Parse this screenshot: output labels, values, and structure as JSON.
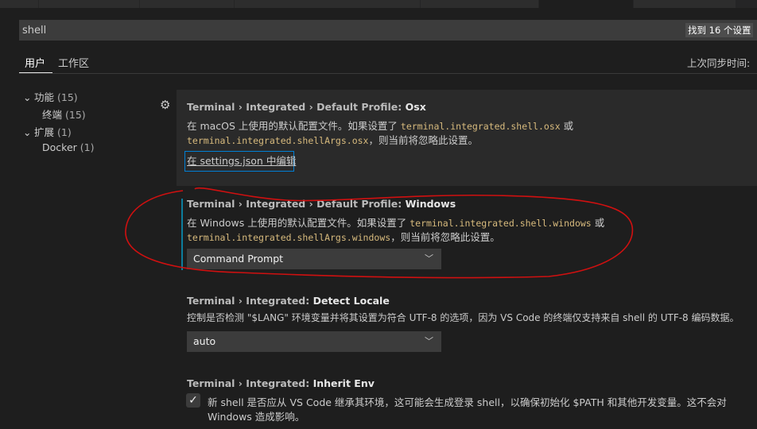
{
  "search": {
    "value": "shell",
    "result_count": "找到 16 个设置"
  },
  "scope_tabs": [
    {
      "label": "用户",
      "active": true
    },
    {
      "label": "工作区",
      "active": false
    }
  ],
  "sync_status": "上次同步时间: ",
  "tree": [
    {
      "label": "功能",
      "count": "(15)",
      "expanded": true
    },
    {
      "label": "终端",
      "count": "(15)"
    },
    {
      "label": "扩展",
      "count": "(1)",
      "expanded": true
    },
    {
      "label": "Docker",
      "count": "(1)"
    }
  ],
  "settings": [
    {
      "category": "Terminal › Integrated › Default Profile: ",
      "name": "Osx",
      "desc_a": "在 macOS 上使用的默认配置文件。如果设置了 ",
      "code1": "terminal.integrated.shell.osx",
      "desc_b": " 或",
      "code2": "terminal.integrated.shellArgs.osx",
      "desc_c": "，则当前将忽略此设置。",
      "link": "在 settings.json 中编辑"
    },
    {
      "category": "Terminal › Integrated › Default Profile: ",
      "name": "Windows",
      "desc_a": "在 Windows 上使用的默认配置文件。如果设置了 ",
      "code1": "terminal.integrated.shell.windows",
      "desc_b": " 或",
      "code2": "terminal.integrated.shellArgs.windows",
      "desc_c": "，则当前将忽略此设置。",
      "value": "Command Prompt"
    },
    {
      "category": "Terminal › Integrated: ",
      "name": "Detect Locale",
      "desc": "控制是否检测 \"$LANG\" 环境变量并将其设置为符合 UTF-8 的选项，因为 VS Code 的终端仅支持来自 shell 的 UTF-8 编码数据。",
      "value": "auto"
    },
    {
      "category": "Terminal › Integrated: ",
      "name": "Inherit Env",
      "desc_line1": "新 shell 是否应从 VS Code 继承其环境，这可能会生成登录 shell，以确保初始化 $PATH 和其他开发变量。这不会对",
      "desc_line2": "Windows 造成影响。",
      "checked": true
    }
  ],
  "icons": {
    "gear": "gear-icon",
    "chevron": "chevron-down-icon",
    "check": "check-icon"
  },
  "colors": {
    "background": "#1e1e1e",
    "code": "#d7ba7d",
    "focus": "#007fd4",
    "modified_bar": "#0c7d9d",
    "annotation": "#d01010"
  }
}
